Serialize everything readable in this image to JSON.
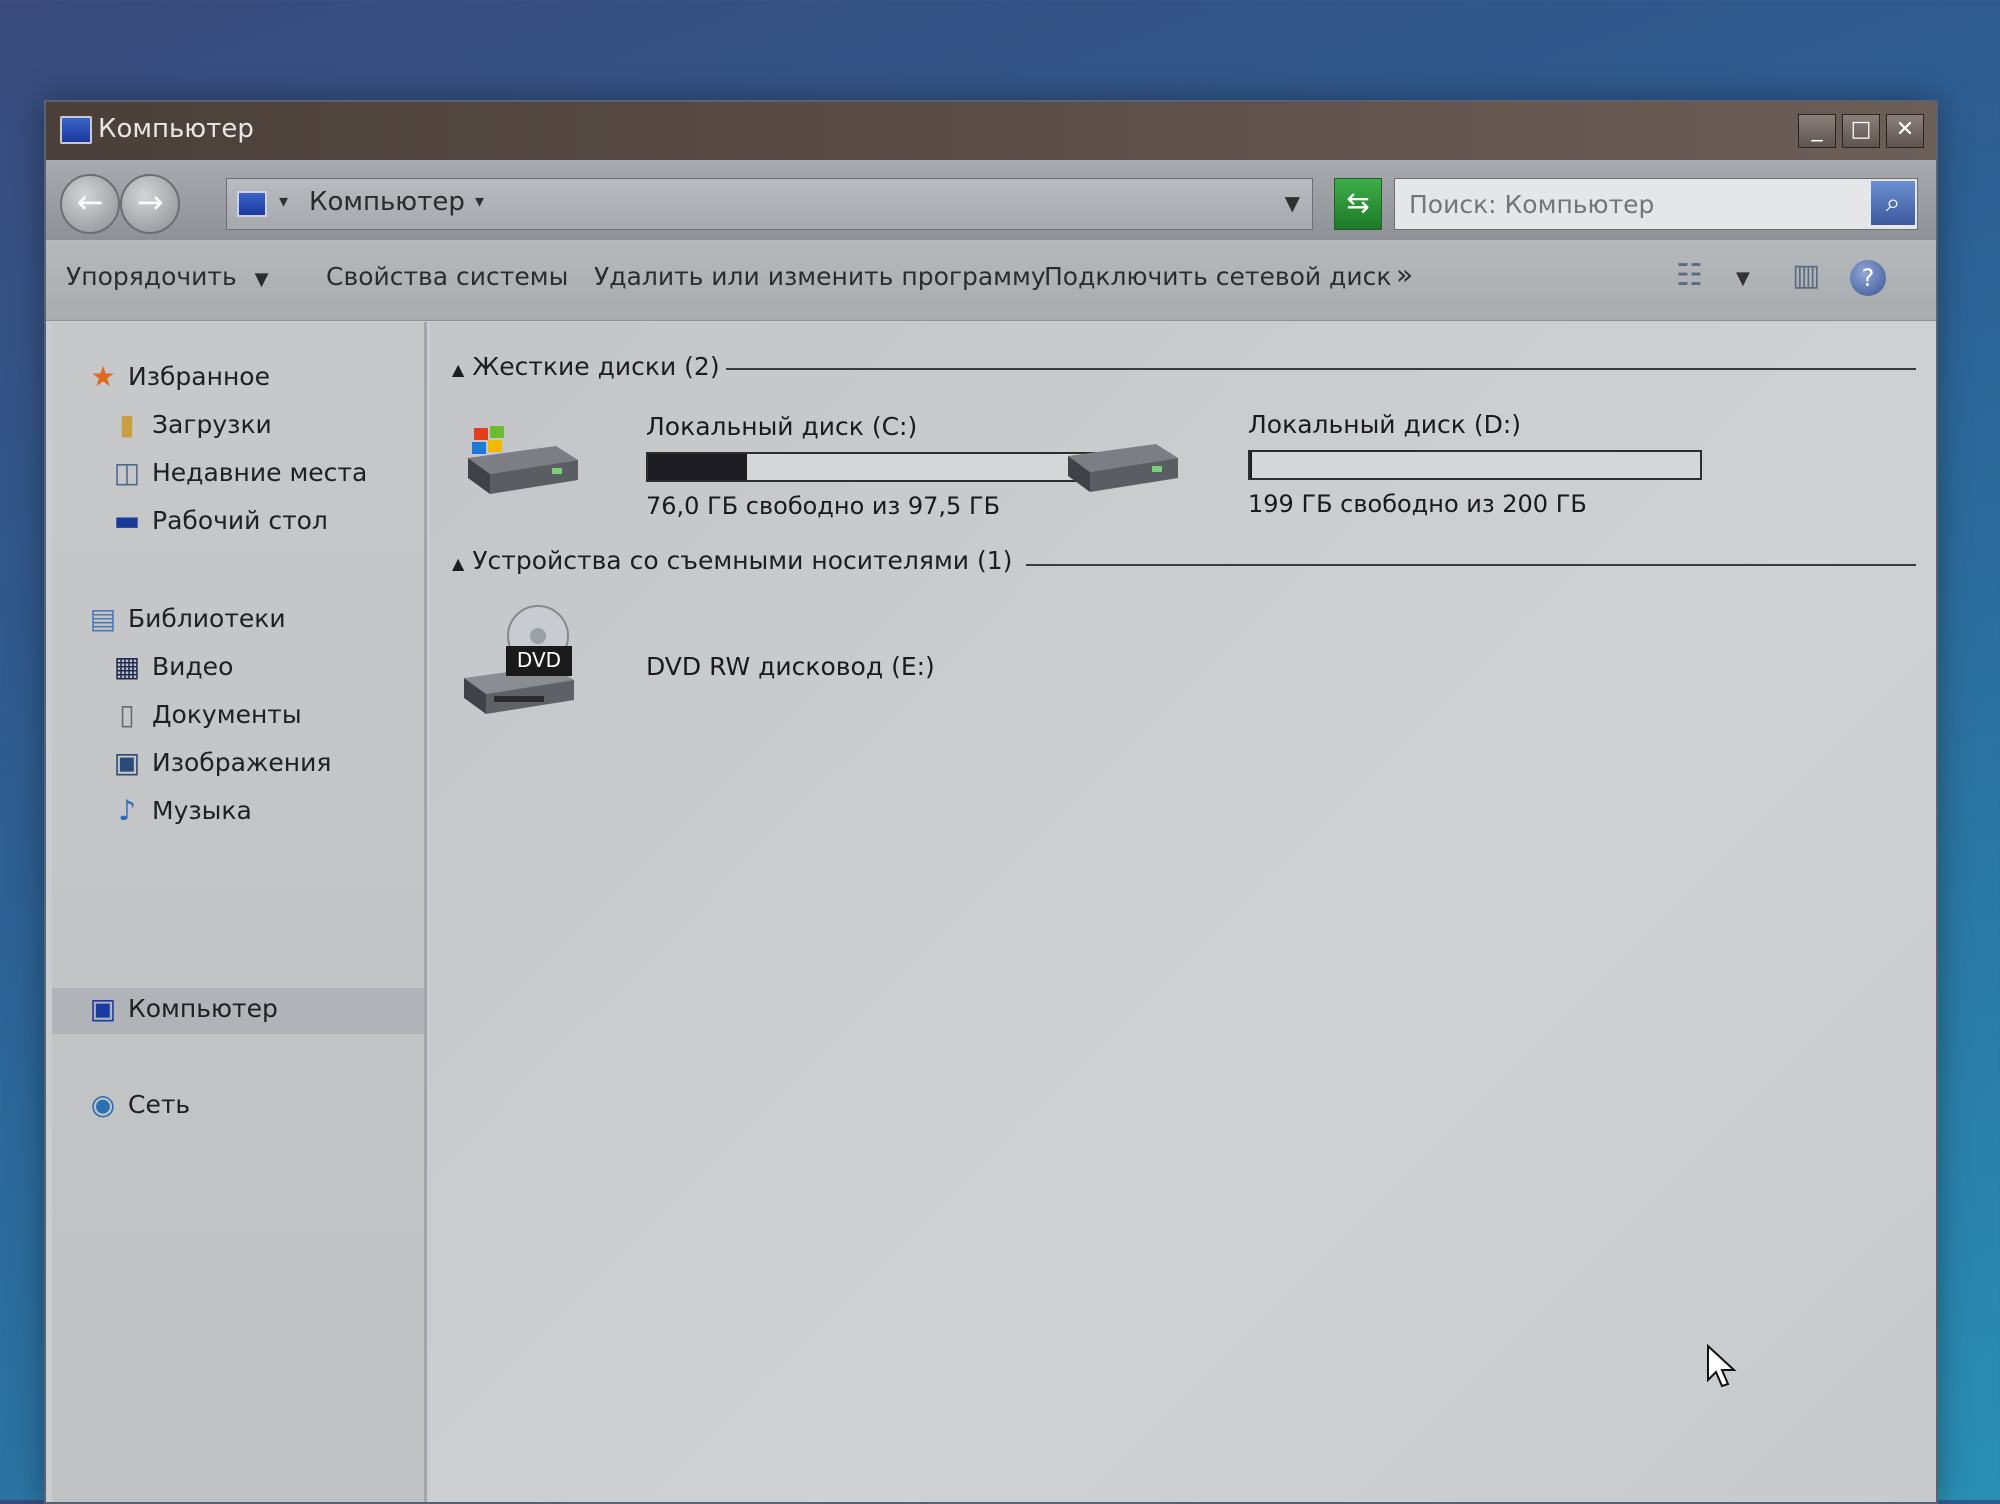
{
  "window": {
    "title": "Компьютер"
  },
  "address": {
    "path": "Компьютер"
  },
  "search": {
    "placeholder": "Поиск: Компьютер"
  },
  "toolbar": {
    "organize": "Упорядочить",
    "system_properties": "Свойства системы",
    "uninstall": "Удалить или изменить программу",
    "map_drive": "Подключить сетевой диск",
    "more": "»"
  },
  "sidebar": {
    "favorites": "Избранное",
    "downloads": "Загрузки",
    "recent": "Недавние места",
    "desktop": "Рабочий стол",
    "libraries": "Библиотеки",
    "video": "Видео",
    "documents": "Документы",
    "images": "Изображения",
    "music": "Музыка",
    "computer": "Компьютер",
    "network": "Сеть"
  },
  "groups": {
    "hard_drives": "Жесткие диски (2)",
    "removable": "Устройства со съемными носителями (1)"
  },
  "drives": [
    {
      "label": "Локальный диск (C:)",
      "free_text": "76,0 ГБ свободно из 97,5 ГБ",
      "used_fraction": 0.22
    },
    {
      "label": "Локальный диск (D:)",
      "free_text": "199 ГБ свободно из 200 ГБ",
      "used_fraction": 0.005
    }
  ],
  "dvd": {
    "label": "DVD RW дисковод (E:)",
    "badge": "DVD"
  },
  "colors": {
    "bar_fill": "#1c1c22",
    "titlebar": "#4b3f3a"
  }
}
